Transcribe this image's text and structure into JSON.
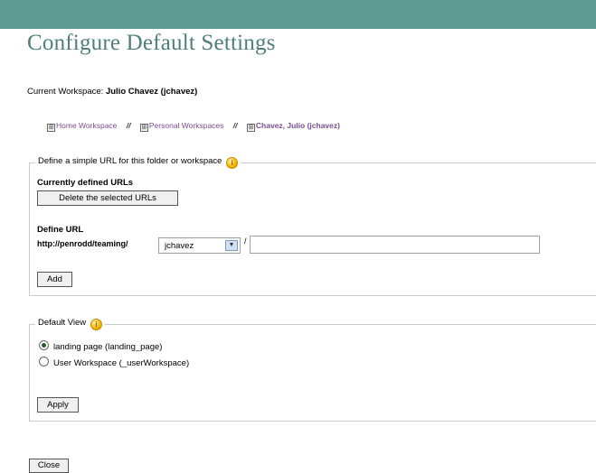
{
  "page": {
    "title": "Configure Default Settings",
    "workspace_label": "Current Workspace:",
    "workspace_name": "Julio Chavez (jchavez)"
  },
  "breadcrumb": {
    "items": [
      {
        "label": "Home Workspace",
        "expander": "⊞"
      },
      {
        "label": "Personal Workspaces",
        "expander": "⊞"
      },
      {
        "label": "Chavez, Julio (jchavez)",
        "expander": "⊞"
      }
    ],
    "separator": "//"
  },
  "url_section": {
    "legend": "Define a simple URL for this folder or workspace",
    "info_icon": "i",
    "currently_defined_label": "Currently defined URLs",
    "delete_button": "Delete the selected URLs",
    "define_label": "Define URL",
    "base_url": "http://penrodd/teaming/",
    "select_value": "jchavez",
    "slash": "/",
    "url_input_value": "",
    "add_button": "Add"
  },
  "view_section": {
    "legend": "Default View",
    "info_icon": "i",
    "options": [
      {
        "label": "landing page (landing_page)",
        "selected": true
      },
      {
        "label": "User Workspace (_userWorkspace)",
        "selected": false
      }
    ],
    "apply_button": "Apply"
  },
  "footer": {
    "close_button": "Close"
  },
  "colors": {
    "top_bar": "#5f9a91",
    "title": "#4e7f7b",
    "link": "#7a4c92"
  }
}
